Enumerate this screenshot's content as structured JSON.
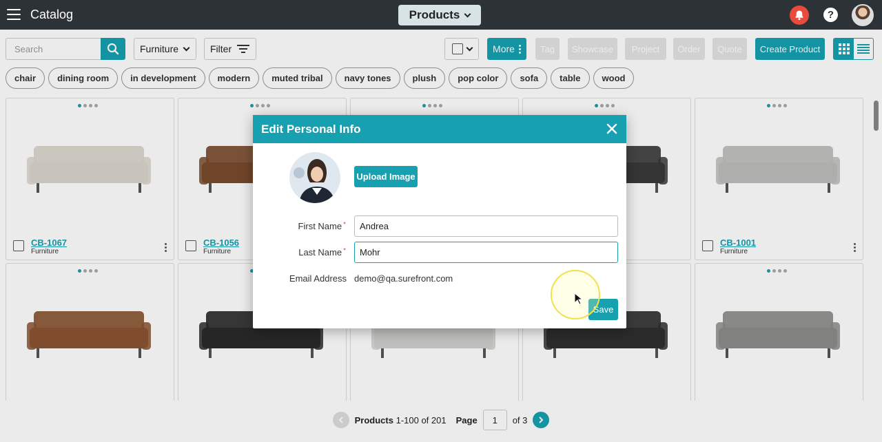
{
  "header": {
    "app_title": "Catalog",
    "section_selector": "Products",
    "help_label": "?"
  },
  "toolbar": {
    "search_placeholder": "Search",
    "category_selected": "Furniture",
    "filter_label": "Filter",
    "more_label": "More",
    "tag_label": "Tag",
    "showcase_label": "Showcase",
    "project_label": "Project",
    "order_label": "Order",
    "quote_label": "Quote",
    "create_label": "Create Product"
  },
  "tags": [
    "chair",
    "dining room",
    "in development",
    "modern",
    "muted tribal",
    "navy tones",
    "plush",
    "pop color",
    "sofa",
    "table",
    "wood"
  ],
  "products": [
    {
      "code": "CB-1067",
      "category": "Furniture",
      "color": "#d9d5cc"
    },
    {
      "code": "CB-1056",
      "category": "Furniture",
      "color": "#7a4a2c"
    },
    {
      "code": "",
      "category": "",
      "color": "#e0e0e0"
    },
    {
      "code": "",
      "category": "",
      "color": "#3a3a3a"
    },
    {
      "code": "CB-1001",
      "category": "Furniture",
      "color": "#bdbdbb"
    },
    {
      "code": "",
      "category": "",
      "color": "#8a5431"
    },
    {
      "code": "",
      "category": "",
      "color": "#2a2a2a"
    },
    {
      "code": "",
      "category": "",
      "color": "#cfd0cc"
    },
    {
      "code": "",
      "category": "",
      "color": "#2f2f2f"
    },
    {
      "code": "",
      "category": "",
      "color": "#8c8c8a"
    }
  ],
  "pagination": {
    "label": "Products",
    "range": "1-100 of 201",
    "page_label": "Page",
    "page_value": "1",
    "of_label": "of 3"
  },
  "modal": {
    "title": "Edit Personal Info",
    "upload_label": "Upload Image",
    "first_name_label": "First Name",
    "first_name_value": "Andrea",
    "last_name_label": "Last Name",
    "last_name_value": "Mohr",
    "email_label": "Email Address",
    "email_value": "demo@qa.surefront.com",
    "required_mark": "*",
    "save_label": "Save"
  },
  "colors": {
    "accent": "#16a0b0",
    "topbar": "#2d3236",
    "alert": "#e84a3d"
  }
}
